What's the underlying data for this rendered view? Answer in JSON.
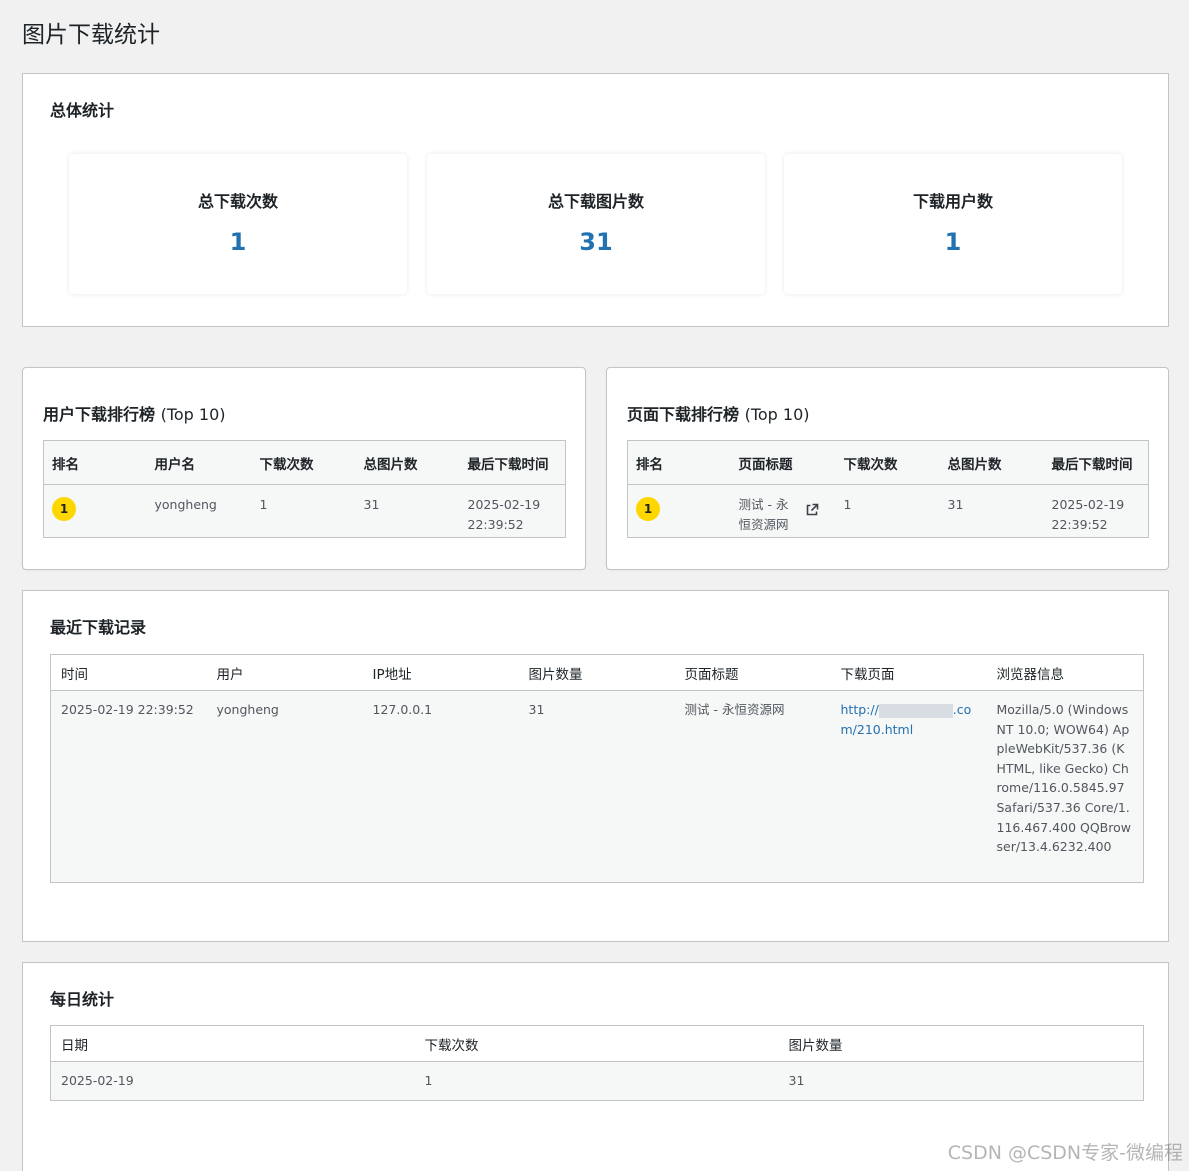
{
  "page_title": "图片下载统计",
  "overview": {
    "title": "总体统计",
    "stats": [
      {
        "label": "总下载次数",
        "value": "1"
      },
      {
        "label": "总下载图片数",
        "value": "31"
      },
      {
        "label": "下载用户数",
        "value": "1"
      }
    ]
  },
  "user_rank": {
    "title": "用户下载排行榜",
    "title_suffix": "(Top 10)",
    "columns": [
      "排名",
      "用户名",
      "下载次数",
      "总图片数",
      "最后下载时间"
    ],
    "rows": [
      {
        "rank": "1",
        "username": "yongheng",
        "downloads": "1",
        "images": "31",
        "last_date": "2025-02-19",
        "last_time": "22:39:52"
      }
    ]
  },
  "page_rank": {
    "title": "页面下载排行榜",
    "title_suffix": "(Top 10)",
    "columns": [
      "排名",
      "页面标题",
      "下载次数",
      "总图片数",
      "最后下载时间"
    ],
    "rows": [
      {
        "rank": "1",
        "page_title_l1": "测试 - 永",
        "page_title_l2": "恒资源网",
        "icon": "external-link-icon",
        "downloads": "1",
        "images": "31",
        "last_date": "2025-02-19",
        "last_time": "22:39:52"
      }
    ]
  },
  "recent": {
    "title": "最近下载记录",
    "columns": [
      "时间",
      "用户",
      "IP地址",
      "图片数量",
      "页面标题",
      "下载页面",
      "浏览器信息"
    ],
    "rows": [
      {
        "time": "2025-02-19 22:39:52",
        "user": "yongheng",
        "ip": "127.0.0.1",
        "count": "31",
        "page_title": "测试 - 永恒资源网",
        "url_prefix": "http://",
        "url_suffix": ".com/210.html",
        "browser": "Mozilla/5.0 (Windows NT 10.0; WOW64) AppleWebKit/537.36 (KHTML, like Gecko) Chrome/116.0.5845.97 Safari/537.36 Core/1.116.467.400 QQBrowser/13.4.6232.400"
      }
    ]
  },
  "daily": {
    "title": "每日统计",
    "columns": [
      "日期",
      "下载次数",
      "图片数量"
    ],
    "rows": [
      {
        "date": "2025-02-19",
        "downloads": "1",
        "images": "31"
      }
    ]
  },
  "watermark": "CSDN @CSDN专家-微编程",
  "colors": {
    "accent": "#2271b1",
    "badge": "#ffd700",
    "border": "#c3c4c7",
    "bg": "#f1f1f1"
  }
}
